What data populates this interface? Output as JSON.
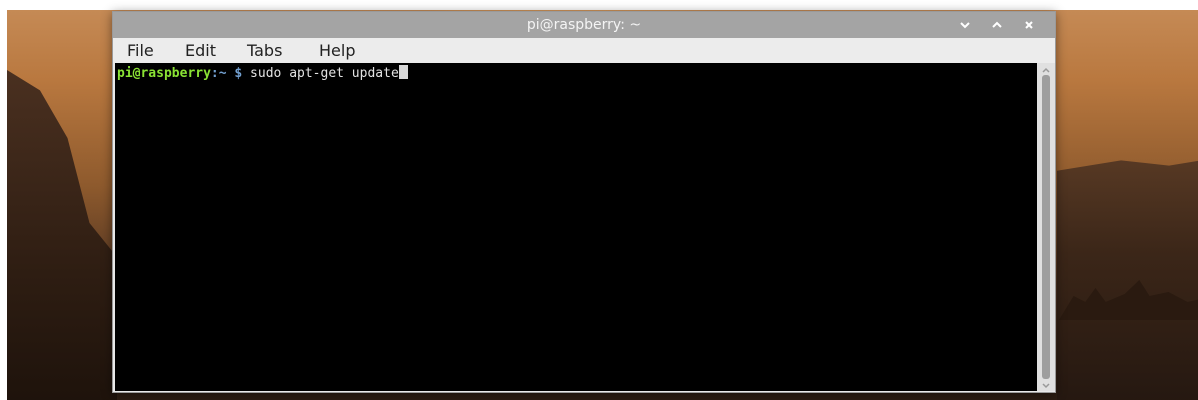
{
  "window": {
    "title": "pi@raspberry: ~"
  },
  "titlebar_buttons": [
    {
      "icon": "chevron-down-icon",
      "action": "minimize"
    },
    {
      "icon": "chevron-up-icon",
      "action": "maximize"
    },
    {
      "icon": "close-icon",
      "action": "close"
    }
  ],
  "menu": {
    "file": "File",
    "edit": "Edit",
    "tabs": "Tabs",
    "help": "Help"
  },
  "terminal": {
    "prompt_user": "pi@raspberry",
    "prompt_path": ":~",
    "prompt_sign": " $",
    "command": " sudo apt-get update"
  },
  "colors": {
    "titlebar": "#a4a4a4",
    "terminal_bg": "#000000",
    "prompt_user": "#8ae234",
    "prompt_path": "#729fcf"
  }
}
